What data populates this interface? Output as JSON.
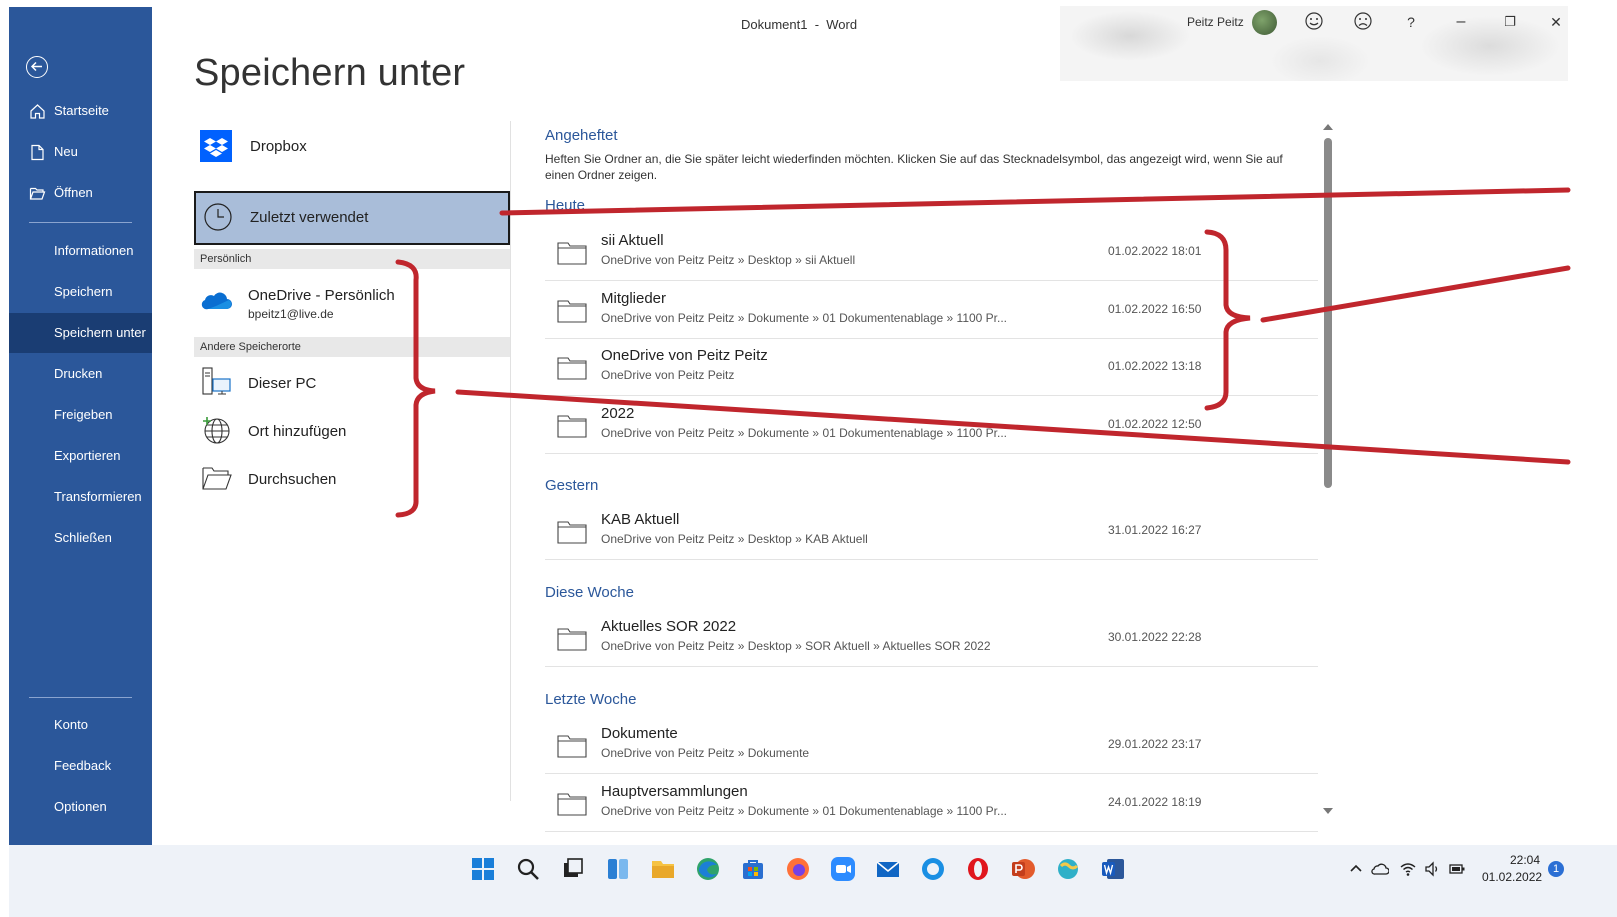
{
  "window": {
    "title": "Dokument1  -  Word",
    "user": "Peitz Peitz",
    "buttons": {
      "minimize": "–",
      "restore": "❐",
      "close": "✕",
      "help": "?"
    }
  },
  "nav": {
    "items": [
      {
        "label": "Startseite"
      },
      {
        "label": "Neu"
      },
      {
        "label": "Öffnen"
      },
      {
        "label": "Informationen"
      },
      {
        "label": "Speichern"
      },
      {
        "label": "Speichern unter"
      },
      {
        "label": "Drucken"
      },
      {
        "label": "Freigeben"
      },
      {
        "label": "Exportieren"
      },
      {
        "label": "Transformieren"
      },
      {
        "label": "Schließen"
      },
      {
        "label": "Konto"
      },
      {
        "label": "Feedback"
      },
      {
        "label": "Optionen"
      }
    ]
  },
  "page": {
    "title": "Speichern unter"
  },
  "locations": {
    "dropbox": "Dropbox",
    "recent": "Zuletzt verwendet",
    "personal_header": "Persönlich",
    "onedrive": "OneDrive - Persönlich",
    "onedrive_account": "bpeitz1@live.de",
    "other_header": "Andere Speicherorte",
    "this_pc": "Dieser PC",
    "add_place": "Ort hinzufügen",
    "browse": "Durchsuchen"
  },
  "recent": {
    "pinned_title": "Angeheftet",
    "pinned_help": "Heften Sie Ordner an, die Sie später leicht wiederfinden möchten. Klicken Sie auf das Stecknadelsymbol, das angezeigt wird, wenn Sie auf einen Ordner zeigen.",
    "today_title": "Heute",
    "today": [
      {
        "name": "sii Aktuell",
        "path": "OneDrive von Peitz Peitz » Desktop » sii Aktuell",
        "date": "01.02.2022 18:01"
      },
      {
        "name": "Mitglieder",
        "path": "OneDrive von Peitz Peitz » Dokumente » 01 Dokumentenablage » 1100 Pr...",
        "date": "01.02.2022 16:50"
      },
      {
        "name": "OneDrive von Peitz Peitz",
        "path": "OneDrive von Peitz Peitz",
        "date": "01.02.2022 13:18"
      },
      {
        "name": "2022",
        "path": "OneDrive von Peitz Peitz » Dokumente » 01 Dokumentenablage » 1100 Pr...",
        "date": "01.02.2022 12:50"
      }
    ],
    "yesterday_title": "Gestern",
    "yesterday": [
      {
        "name": "KAB Aktuell",
        "path": "OneDrive von Peitz Peitz » Desktop » KAB Aktuell",
        "date": "31.01.2022 16:27"
      }
    ],
    "week_title": "Diese Woche",
    "week": [
      {
        "name": "Aktuelles SOR 2022",
        "path": "OneDrive von Peitz Peitz » Desktop » SOR Aktuell » Aktuelles SOR 2022",
        "date": "30.01.2022 22:28"
      }
    ],
    "lastweek_title": "Letzte Woche",
    "lastweek": [
      {
        "name": "Dokumente",
        "path": "OneDrive von Peitz Peitz » Dokumente",
        "date": "29.01.2022 23:17"
      },
      {
        "name": "Hauptversammlungen",
        "path": "OneDrive von Peitz Peitz » Dokumente » 01 Dokumentenablage » 1100 Pr...",
        "date": "24.01.2022 18:19"
      }
    ]
  },
  "taskbar": {
    "time": "22:04",
    "date": "01.02.2022",
    "notifications": "1"
  },
  "colors": {
    "nav": "#2b579a",
    "accent": "#2b579a",
    "annotation": "#c0262d"
  }
}
